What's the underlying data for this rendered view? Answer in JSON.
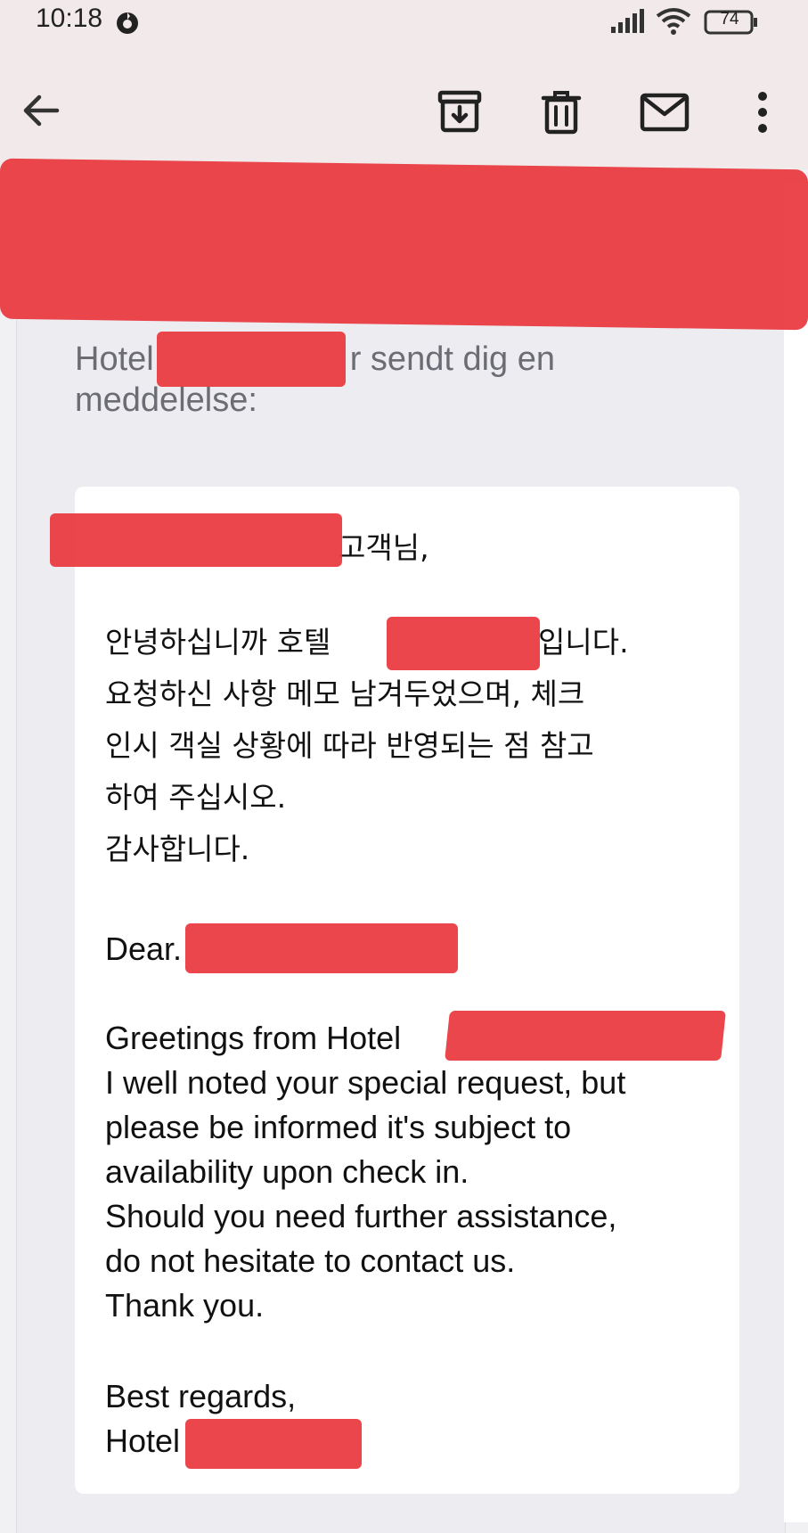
{
  "status_bar": {
    "time": "10:18",
    "battery": "74"
  },
  "toolbar": {
    "icons": [
      "arrow-back-icon",
      "archive-icon",
      "trash-icon",
      "mail-icon",
      "more-vert-icon"
    ]
  },
  "email": {
    "intro_line1_a": "Hotel",
    "intro_line1_b": "r sendt dig en",
    "intro_line2": "meddelelse:",
    "salutation_kr_suffix": "고객님,",
    "kr_line1_a": "안녕하십니까 호텔",
    "kr_line1_b": "입니다.",
    "kr_line2": "요청하신 사항 메모 남겨두었으며, 체크",
    "kr_line3": "인시 객실 상황에 따라 반영되는 점 참고",
    "kr_line4": "하여 주십시오.",
    "kr_line5": "감사합니다.",
    "dear": "Dear.",
    "greetings": "Greetings from Hotel",
    "en_line1": "I well noted your special request, but",
    "en_line2": "please be informed it's subject to",
    "en_line3": "availability upon check in.",
    "en_line4": "Should you need further assistance,",
    "en_line5": "do not hesitate to contact us.",
    "en_line6": "Thank you.",
    "closing": "Best regards,",
    "signature": "Hotel"
  },
  "colors": {
    "redaction": "#e8363d",
    "header_bg": "#f2eaea",
    "card_bg": "#ffffff",
    "outer_bg": "#ececf1"
  }
}
